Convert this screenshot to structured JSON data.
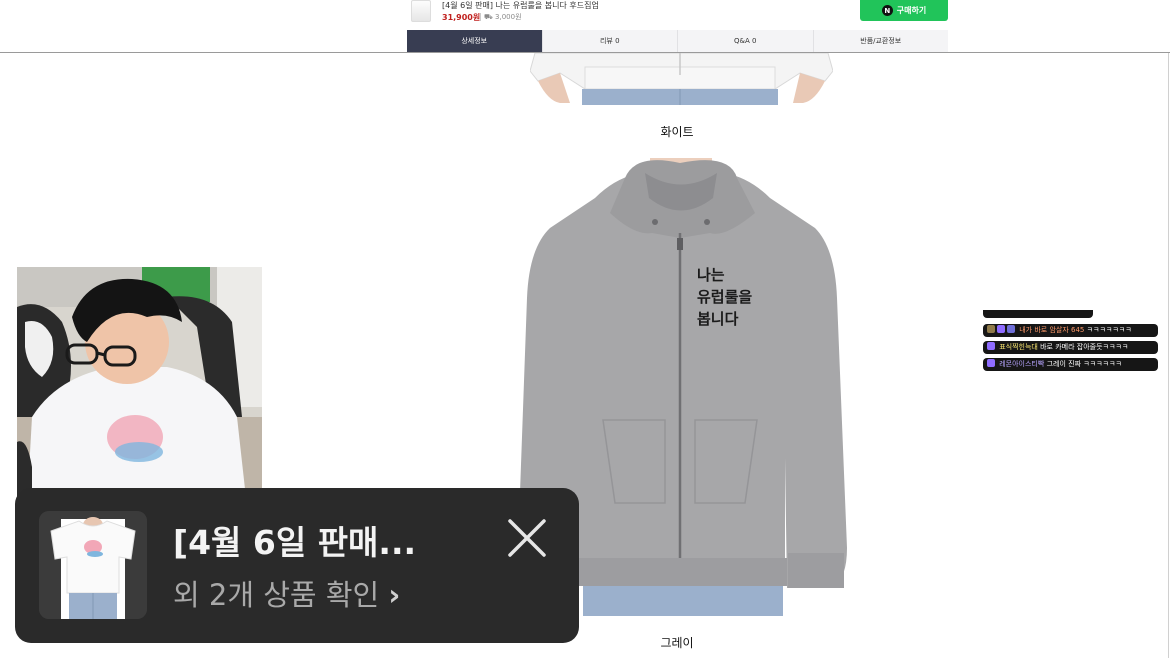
{
  "product_bar": {
    "name": "[4월 6일 판매] 나는 유럽룰을 봅니다 후드집업",
    "price": "31,900원",
    "shipping": "3,000원",
    "buy_label": "구매하기",
    "npay_icon": "N"
  },
  "tabs": [
    {
      "label": "상세정보",
      "active": true
    },
    {
      "label": "리뷰 0",
      "active": false
    },
    {
      "label": "Q&A 0",
      "active": false
    },
    {
      "label": "반품/교환정보",
      "active": false
    }
  ],
  "captions": {
    "white": "화이트",
    "gray": "그레이"
  },
  "hoodie_print": [
    "나는",
    "유럽룰을",
    "봅니다"
  ],
  "chat": [
    {
      "nick": "내가 바로 암살자 645",
      "text": "ㅋㅋㅋㅋㅋㅋㅋ"
    },
    {
      "nick": "표식찍힌늑대",
      "text": "바로 카메라 잡아줄듯ㅋㅋㅋㅋ"
    },
    {
      "nick": "레몬아이스티빡",
      "text": "그레이 진짜 ㅋㅋㅋㅋㅋㅋ"
    }
  ],
  "popup": {
    "title": "[4월 6일 판매...",
    "subtitle": "외 2개 상품 확인",
    "chevron": "›"
  },
  "colors": {
    "buy_green": "#21c45a",
    "tab_active": "#383d52",
    "price_red": "#c0201e",
    "hoodie_gray": "#a9a9ab",
    "popup_bg": "#2a2a2a"
  }
}
